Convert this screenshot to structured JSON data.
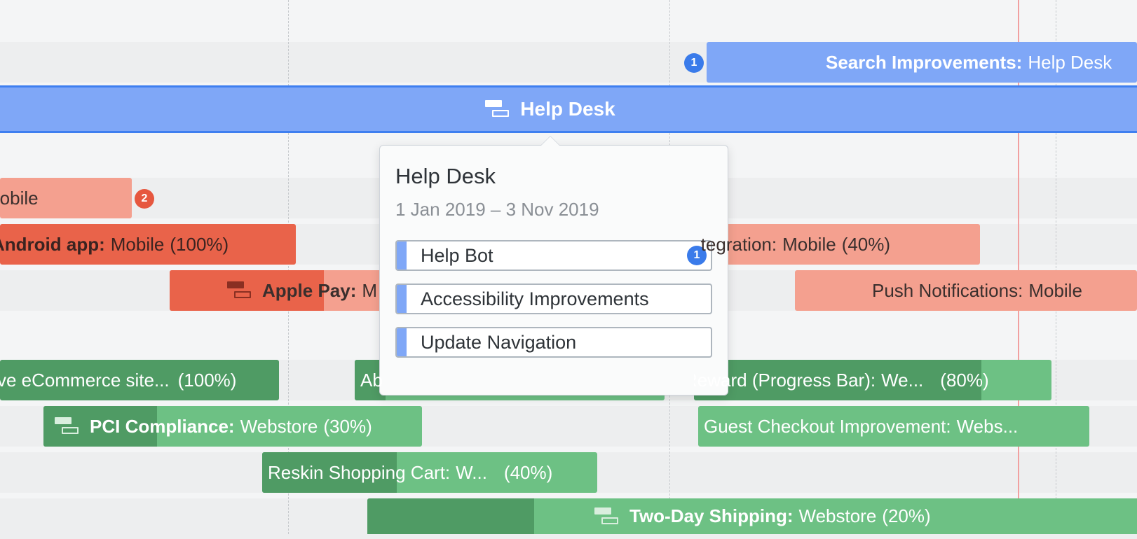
{
  "colors": {
    "blue": "#7fa7f7",
    "blue_border": "#3f7ff0",
    "badge_blue": "#3a7bea",
    "red_light": "#f4a08f",
    "red_dark": "#e9634a",
    "badge_red": "#e6573f",
    "green_light": "#6dc184",
    "green_dark": "#4f9b64",
    "today_line": "#f1a0a0"
  },
  "bars": {
    "search": {
      "title": "Search Improvements:",
      "team": "Help Desk",
      "badge": "1"
    },
    "help_desk": {
      "title": "Help Desk",
      "icon": "epic-icon"
    },
    "mobile_partial": {
      "team": "Mobile",
      "badge": "2"
    },
    "android": {
      "title": "Android app:",
      "team": "Mobile",
      "pct": "(100%)"
    },
    "apple_pay": {
      "title": "Apple Pay:",
      "team": "M",
      "icon": "epic-icon"
    },
    "integration": {
      "title": "Integration:",
      "team": "Mobile",
      "pct": "(40%)"
    },
    "push": {
      "title": "Push Notifications:",
      "team": "Mobile"
    },
    "ecommerce": {
      "title": "ve eCommerce site...",
      "pct": "(100%)"
    },
    "ab": {
      "title": "Ab"
    },
    "reward": {
      "title": "Reward (Progress Bar):",
      "team": "We...",
      "pct": "(80%)"
    },
    "pci": {
      "title": "PCI Compliance:",
      "team": "Webstore",
      "pct": "(30%)",
      "icon": "epic-icon"
    },
    "guest": {
      "title": "Guest Checkout Improvement:",
      "team": "Webs..."
    },
    "reskin": {
      "title": "Reskin Shopping Cart:",
      "team": "W...",
      "pct": "(40%)"
    },
    "two_day": {
      "title": "Two-Day Shipping:",
      "team": "Webstore",
      "pct": "(20%)",
      "icon": "epic-icon"
    }
  },
  "popover": {
    "title": "Help Desk",
    "dates": "1 Jan 2019 – 3 Nov 2019",
    "items": [
      {
        "label": "Help Bot",
        "badge": "1"
      },
      {
        "label": "Accessibility Improvements"
      },
      {
        "label": "Update Navigation"
      }
    ]
  }
}
